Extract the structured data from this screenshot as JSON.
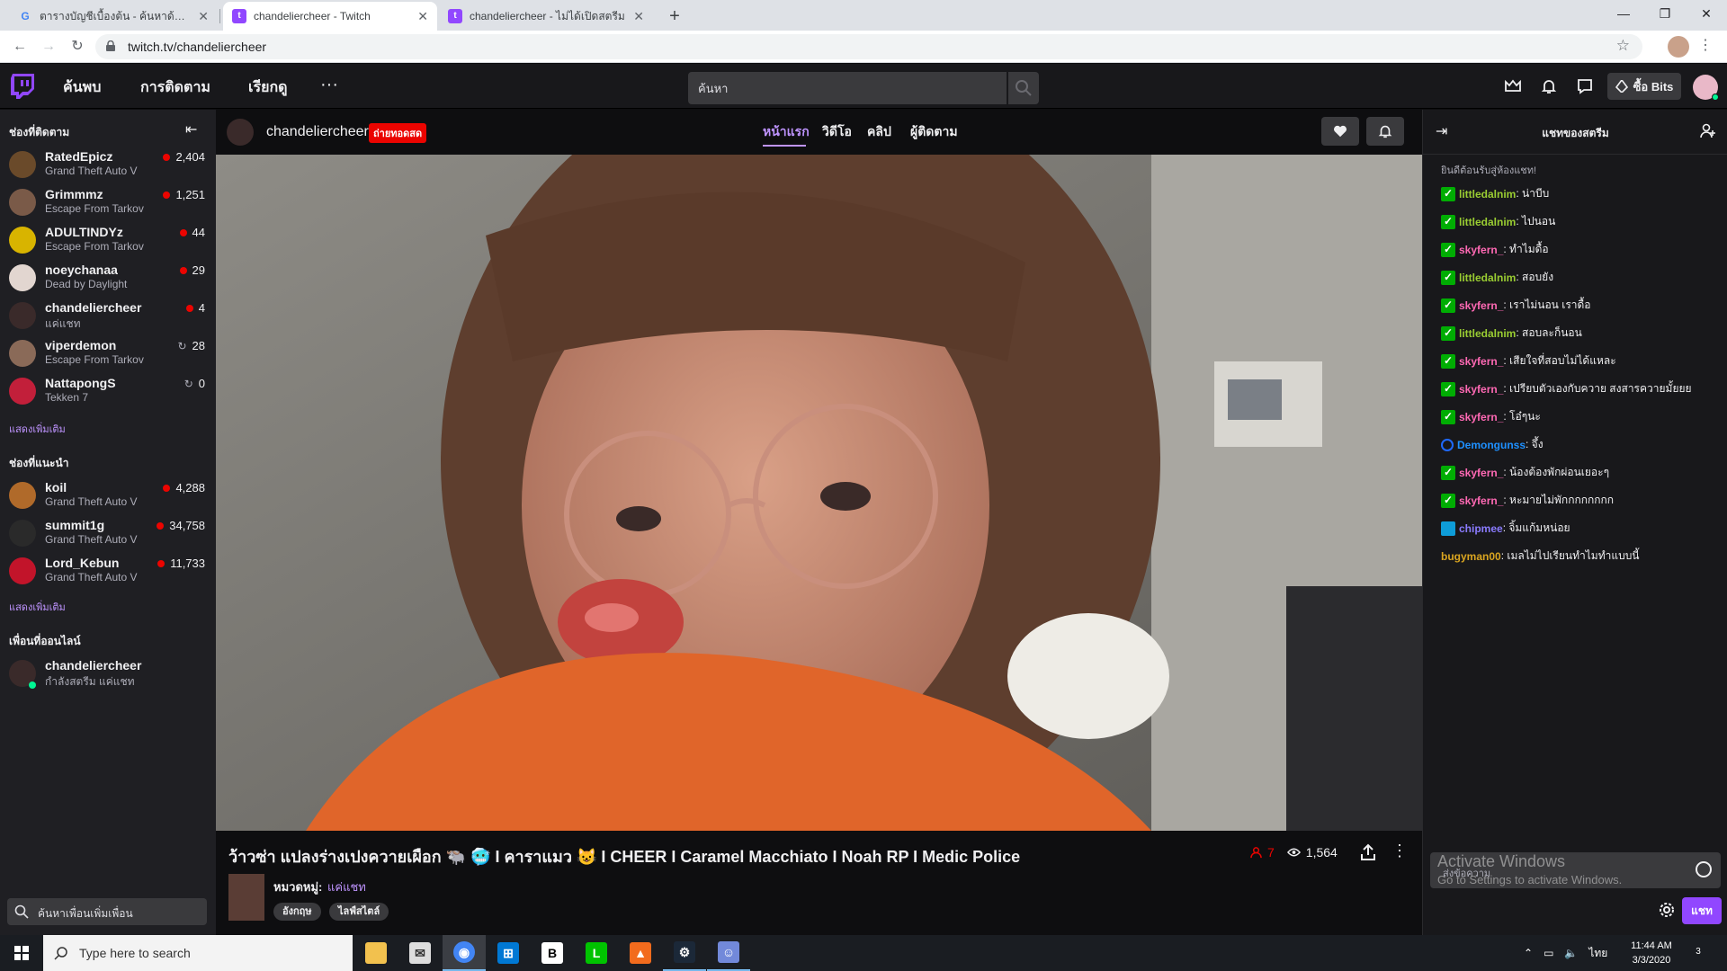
{
  "browser": {
    "tabs": [
      {
        "title": "ตารางบัญชีเบื้องต้น - ค้นหาด้วย Goog",
        "favicon": "google-icon"
      },
      {
        "title": "chandeliercheer - Twitch",
        "favicon": "twitch-icon"
      },
      {
        "title": "chandeliercheer - ไม่ได้เปิดสตรีม",
        "favicon": "twitch-icon"
      }
    ],
    "url": "twitch.tv/chandeliercheer"
  },
  "topnav": {
    "browse": "ค้นพบ",
    "following": "การติดตาม",
    "esports": "เรียกดู",
    "search_placeholder": "ค้นหา",
    "bits_label": "ซื้อ Bits"
  },
  "sidebar": {
    "followed_heading": "ช่องที่ติดตาม",
    "followed": [
      {
        "name": "RatedEpicz",
        "game": "Grand Theft Auto V",
        "viewers": "2,404",
        "live": true,
        "avatar_color": "#6a4a2a"
      },
      {
        "name": "Grimmmz",
        "game": "Escape From Tarkov",
        "viewers": "1,251",
        "live": true,
        "avatar_color": "#7a5a48"
      },
      {
        "name": "ADULTINDYz",
        "game": "Escape From Tarkov",
        "viewers": "44",
        "live": true,
        "avatar_color": "#d8b400"
      },
      {
        "name": "noeychanaa",
        "game": "Dead by Daylight",
        "viewers": "29",
        "live": true,
        "avatar_color": "#e2d6d0"
      },
      {
        "name": "chandeliercheer",
        "game": "แค่แชท",
        "viewers": "4",
        "live": true,
        "avatar_color": "#3a2a2a"
      },
      {
        "name": "viperdemon",
        "game": "Escape From Tarkov",
        "viewers": "28",
        "live": false,
        "avatar_color": "#8a6a58"
      },
      {
        "name": "NattapongS",
        "game": "Tekken 7",
        "viewers": "0",
        "live": false,
        "avatar_color": "#c21f3a"
      }
    ],
    "show_more_1": "แสดงเพิ่มเติม",
    "recommended_heading": "ช่องที่แนะนำ",
    "recommended": [
      {
        "name": "koil",
        "game": "Grand Theft Auto V",
        "viewers": "4,288",
        "avatar_color": "#b06a2a"
      },
      {
        "name": "summit1g",
        "game": "Grand Theft Auto V",
        "viewers": "34,758",
        "avatar_color": "#2a2a2a"
      },
      {
        "name": "Lord_Kebun",
        "game": "Grand Theft Auto V",
        "viewers": "11,733",
        "avatar_color": "#c2142a"
      }
    ],
    "show_more_2": "แสดงเพิ่มเติม",
    "friends_heading": "เพื่อนที่ออนไลน์",
    "friend": {
      "name": "chandeliercheer",
      "status": "กำลังสตรีม แค่แชท"
    },
    "friend_search_placeholder": "ค้นหาเพื่อนเพิ่มเพื่อน"
  },
  "channel": {
    "name": "chandeliercheer",
    "live_badge": "ถ่ายทอดสด",
    "tabs": [
      "หน้าแรก",
      "วิดีโอ",
      "คลิป",
      "ผู้ติดตาม"
    ],
    "active_tab": "หน้าแรก"
  },
  "stream": {
    "title": "ว้าวซ่า แปลงร่างเปงควายเผือก 🐃 🥶 I คาราแมว 😺 I CHEER I Caramel Macchiato I Noah RP I Medic Police",
    "followers": "7",
    "viewers": "1,564",
    "category_label": "หมวดหมู่:",
    "category_value": "แค่แชท",
    "tags": [
      "อังกฤษ",
      "ไลฟ์สไตล์"
    ]
  },
  "chat": {
    "title": "แชทของสตรีม",
    "welcome": "ยินดีต้อนรับสู่ห้องแชท!",
    "messages": [
      {
        "user": "littledalnim",
        "text": ": น่าบีบ",
        "color": "#9acd32",
        "badge": "mod"
      },
      {
        "user": "littledalnim",
        "text": ": ไปนอน",
        "color": "#9acd32",
        "badge": "mod"
      },
      {
        "user": "skyfern_",
        "text": ": ทำไมดื้อ",
        "color": "#ff69b4",
        "badge": "mod"
      },
      {
        "user": "littledalnim",
        "text": ": สอบยัง",
        "color": "#9acd32",
        "badge": "mod"
      },
      {
        "user": "skyfern_",
        "text": ": เราไม่นอน เราดื้อ",
        "color": "#ff69b4",
        "badge": "mod"
      },
      {
        "user": "littledalnim",
        "text": ": สอบละก็นอน",
        "color": "#9acd32",
        "badge": "mod"
      },
      {
        "user": "skyfern_",
        "text": ": เสียใจที่สอบไม่ได้แหละ",
        "color": "#ff69b4",
        "badge": "mod"
      },
      {
        "user": "skyfern_",
        "text": ": เปรียบตัวเองกับควาย สงสารควายมั้ยยย",
        "color": "#ff69b4",
        "badge": "mod"
      },
      {
        "user": "skyfern_",
        "text": ": โอ๋ๆนะ",
        "color": "#ff69b4",
        "badge": "mod"
      },
      {
        "user": "Demongunss",
        "text": ": จึ้ง",
        "color": "#1e90ff",
        "badge": "turbo"
      },
      {
        "user": "skyfern_",
        "text": ": น้องต้องพักผ่อนเยอะๆ",
        "color": "#ff69b4",
        "badge": "mod"
      },
      {
        "user": "skyfern_",
        "text": ": หะมายไม่พักกกกกกกก",
        "color": "#ff69b4",
        "badge": "mod"
      },
      {
        "user": "chipmee",
        "text": ": จิ้มแก้มหน่อย",
        "color": "#8a7bff",
        "badge": "prime"
      },
      {
        "user": "bugyman00",
        "text": ": เมลไม่ไปเรียนทำไมทำแบบนี้",
        "color": "#daa520",
        "badge": ""
      }
    ],
    "input_placeholder": "ส่งข้อความ",
    "send_label": "แชท",
    "activate_title": "Activate Windows",
    "activate_sub": "Go to Settings to activate Windows."
  },
  "taskbar": {
    "search_placeholder": "Type here to search",
    "lang": "ไทย",
    "time": "11:44 AM",
    "date": "3/3/2020",
    "notifications": "3"
  }
}
